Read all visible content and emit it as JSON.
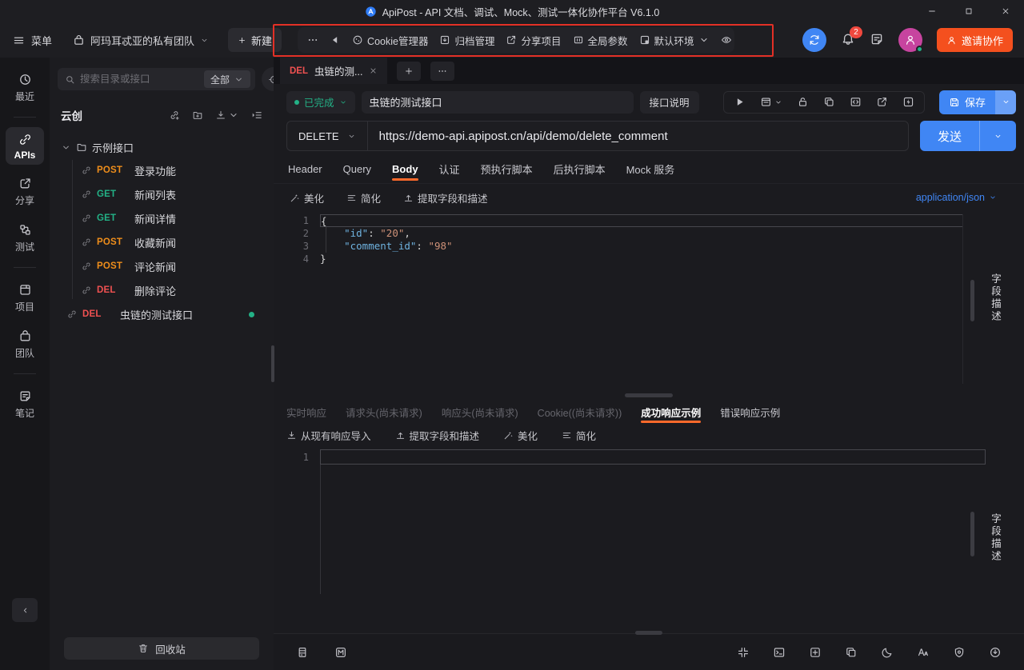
{
  "titlebar": {
    "app_title": "ApiPost - API 文档、调试、Mock、测试一体化协作平台 V6.1.0"
  },
  "header": {
    "menu_label": "菜单",
    "team_name": "阿玛耳忒亚的私有团队",
    "new_button": "新建",
    "quick_toolbar": [
      {
        "key": "more-actions",
        "icon": "more"
      },
      {
        "key": "collapse-back",
        "icon": "back"
      },
      {
        "key": "cookie-manager",
        "icon": "cookie",
        "label": "Cookie管理器"
      },
      {
        "key": "archive-manager",
        "icon": "archive",
        "label": "归档管理"
      },
      {
        "key": "share-project",
        "icon": "shareOut",
        "label": "分享项目"
      },
      {
        "key": "global-params",
        "icon": "grid",
        "label": "全局参数"
      },
      {
        "key": "default-env",
        "icon": "env",
        "label": "默认环境",
        "chevron": true
      },
      {
        "key": "env-preview",
        "icon": "eye"
      }
    ],
    "notification_count": "2",
    "invite_button": "邀请协作"
  },
  "rail": {
    "groups": [
      [
        {
          "key": "recent",
          "icon": "clock",
          "label": "最近"
        }
      ],
      [
        {
          "key": "apis",
          "icon": "link",
          "label": "APIs",
          "active": true
        },
        {
          "key": "share",
          "icon": "shareOut",
          "label": "分享"
        },
        {
          "key": "test",
          "icon": "testFlow",
          "label": "测试"
        }
      ],
      [
        {
          "key": "project",
          "icon": "project",
          "label": "项目"
        },
        {
          "key": "team",
          "icon": "org",
          "label": "团队"
        }
      ],
      [
        {
          "key": "notes",
          "icon": "note",
          "label": "笔记"
        }
      ]
    ]
  },
  "sidebar": {
    "search_placeholder": "搜索目录或接口",
    "search_scope": "全部",
    "project_title": "云创",
    "tree_toolbar": [
      {
        "key": "new-api",
        "icon": "apiAdd"
      },
      {
        "key": "new-folder",
        "icon": "folderAdd"
      },
      {
        "key": "import",
        "icon": "importArrow",
        "chevron": true
      },
      {
        "key": "collapse-all",
        "icon": "collapseList"
      }
    ],
    "folder_name": "示例接口",
    "apis": [
      {
        "method": "POST",
        "name": "登录功能"
      },
      {
        "method": "GET",
        "name": "新闻列表"
      },
      {
        "method": "GET",
        "name": "新闻详情"
      },
      {
        "method": "POST",
        "name": "收藏新闻"
      },
      {
        "method": "POST",
        "name": "评论新闻"
      },
      {
        "method": "DEL",
        "name": "删除评论"
      }
    ],
    "root_api": {
      "method": "DEL",
      "name": "虫链的测试接口",
      "unsaved": true
    },
    "recycle_button": "回收站"
  },
  "workspace": {
    "tab": {
      "method": "DEL",
      "title": "虫链的测..."
    },
    "status_label": "已完成",
    "api_name": "虫链的测试接口",
    "doc_button": "接口说明",
    "action_icons": [
      {
        "key": "run",
        "icon": "play"
      },
      {
        "key": "docs-panel",
        "icon": "docChev",
        "chevron": true
      },
      {
        "key": "lock",
        "icon": "lock"
      },
      {
        "key": "clone",
        "icon": "copy"
      },
      {
        "key": "generate-code",
        "icon": "codeBr"
      },
      {
        "key": "share-api",
        "icon": "shareOut"
      },
      {
        "key": "quick-request",
        "icon": "bolt"
      }
    ],
    "save_button": "保存",
    "method": "DELETE",
    "url": "https://demo-api.apipost.cn/api/demo/delete_comment",
    "send_button": "发送",
    "request_tabs": [
      {
        "label": "Header"
      },
      {
        "label": "Query"
      },
      {
        "label": "Body",
        "active": true
      },
      {
        "label": "认证"
      },
      {
        "label": "预执行脚本"
      },
      {
        "label": "后执行脚本"
      },
      {
        "label": "Mock 服务"
      }
    ],
    "body_toolbar": {
      "beautify": "美化",
      "simplify": "简化",
      "extract": "提取字段和描述",
      "content_type": "application/json"
    },
    "body_code": [
      {
        "num": "1",
        "active": true,
        "tokens": [
          {
            "text": "{",
            "type": "pun"
          }
        ]
      },
      {
        "num": "2",
        "tokens": [
          {
            "text": "    ",
            "type": "pun"
          },
          {
            "text": "\"id\"",
            "type": "key"
          },
          {
            "text": ": ",
            "type": "pun"
          },
          {
            "text": "\"20\"",
            "type": "str"
          },
          {
            "text": ",",
            "type": "pun"
          }
        ]
      },
      {
        "num": "3",
        "tokens": [
          {
            "text": "    ",
            "type": "pun"
          },
          {
            "text": "\"comment_id\"",
            "type": "key"
          },
          {
            "text": ": ",
            "type": "pun"
          },
          {
            "text": "\"98\"",
            "type": "str"
          }
        ]
      },
      {
        "num": "4",
        "tokens": [
          {
            "text": "}",
            "type": "pun"
          }
        ]
      }
    ],
    "field_desc_tab": "字段描述",
    "response_tabs": [
      {
        "label": "实时响应",
        "dim": true
      },
      {
        "label": "请求头(尚未请求)",
        "dim": true
      },
      {
        "label": "响应头(尚未请求)",
        "dim": true
      },
      {
        "label": "Cookie((尚未请求))",
        "dim": true
      },
      {
        "label": "成功响应示例",
        "active": true
      },
      {
        "label": "错误响应示例"
      }
    ],
    "response_toolbar": [
      {
        "key": "import-response",
        "icon": "importArrow",
        "label": "从现有响应导入"
      },
      {
        "key": "extract-fields",
        "icon": "upload",
        "label": "提取字段和描述"
      },
      {
        "key": "beautify",
        "icon": "wand",
        "label": "美化"
      },
      {
        "key": "simplify",
        "icon": "simplifyLines",
        "label": "简化"
      }
    ],
    "response_line_number": "1"
  },
  "statusbar": {
    "left_icons": [
      {
        "key": "services",
        "icon": "server"
      },
      {
        "key": "mock",
        "icon": "mockM"
      }
    ],
    "right_icons": [
      {
        "key": "layout-collapse",
        "icon": "shrink"
      },
      {
        "key": "console",
        "icon": "terminal"
      },
      {
        "key": "new-window",
        "icon": "plusSquare"
      },
      {
        "key": "windows",
        "icon": "copy"
      },
      {
        "key": "theme-dark",
        "icon": "moon"
      },
      {
        "key": "font-size",
        "icon": "fontSize"
      },
      {
        "key": "security",
        "icon": "shield"
      },
      {
        "key": "update",
        "icon": "downloadCircle"
      }
    ]
  },
  "colors": {
    "accent_blue": "#4086f4",
    "tab_accent_orange": "#ff6a2b",
    "invite_orange": "#f4501e",
    "annotation_red": "#e33026",
    "method_post": "#ef8e1b",
    "method_get": "#23b186",
    "method_del": "#f05151",
    "status_done_green": "#23b186",
    "json_key_blue": "#6fb3e0",
    "json_string_orange": "#ce9178"
  }
}
